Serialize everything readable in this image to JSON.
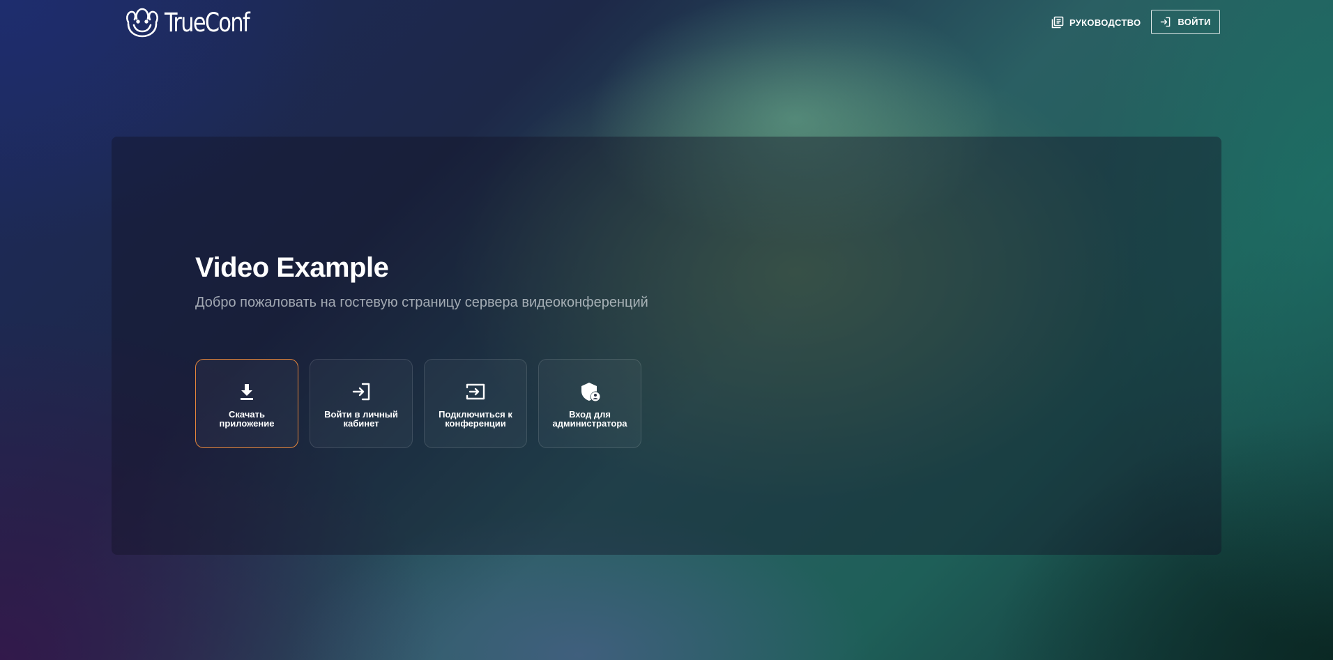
{
  "header": {
    "logo_text": "TrueConf",
    "guide_label": "РУКОВОДСТВО",
    "login_label": "ВОЙТИ"
  },
  "main": {
    "title": "Video Example",
    "subtitle": "Добро пожаловать на гостевую страницу сервера видеоконференций",
    "cards": [
      {
        "label": "Скачать приложение",
        "icon": "download-icon"
      },
      {
        "label": "Войти в личный кабинет",
        "icon": "login-icon"
      },
      {
        "label": "Подключиться к конференции",
        "icon": "join-conference-icon"
      },
      {
        "label": "Вход для администратора",
        "icon": "admin-shield-icon"
      }
    ]
  },
  "colors": {
    "accent": "#e3843a",
    "text": "#ffffff"
  }
}
